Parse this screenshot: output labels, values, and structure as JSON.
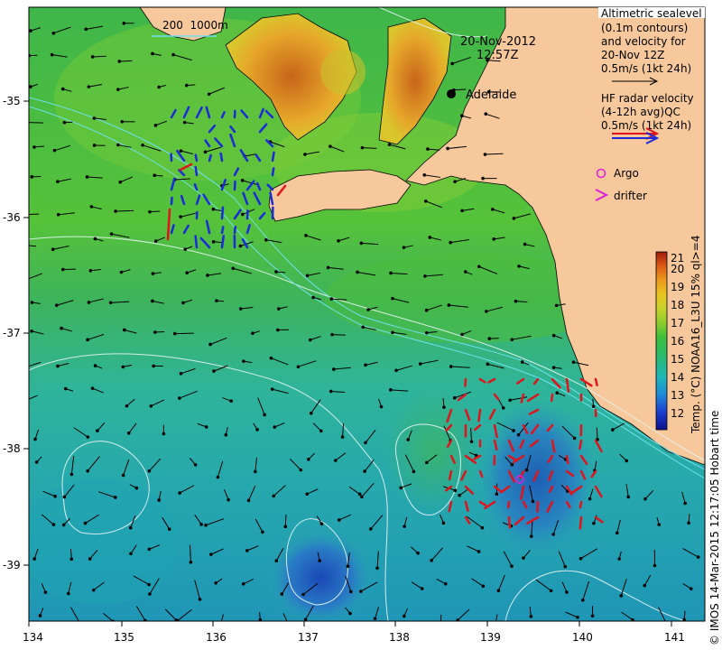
{
  "date_title": "20-Nov-2012",
  "time_title": "12:57Z",
  "place_label": "Adelaide",
  "depth_legend": "200  1000m",
  "sealevel_legend": {
    "lines": [
      "Altimetric sealevel",
      "(0.1m contours)",
      "and velocity for",
      "20-Nov 12Z",
      "0.5m/s (1kt 24h)"
    ]
  },
  "radar_legend": {
    "lines": [
      "HF radar velocity",
      "(4-12h avg)QC",
      "0.5m/s (1kt 24h)"
    ]
  },
  "argo_label": "Argo",
  "drifter_label": "drifter",
  "colorbar": {
    "title": "Temp. (°C) NOAA16_L3U 15% ql>=4",
    "ticks": [
      "12",
      "13",
      "14",
      "15",
      "16",
      "17",
      "18",
      "19",
      "20",
      "21"
    ]
  },
  "credit": "© IMOS 14-Mar-2015 12:17:05 Hobart time",
  "x_ticks": [
    "134",
    "135",
    "136",
    "137",
    "138",
    "139",
    "140",
    "141"
  ],
  "y_ticks": [
    "-35",
    "-36",
    "-37",
    "-38",
    "-39"
  ],
  "colors": {
    "land": "#f6c89b",
    "radar_west": "#1b2bd8",
    "radar_east": "#e0141c",
    "argo": "#e01ee0",
    "contour": "#e8f4f4",
    "isobath": "#6fe0ef"
  }
}
